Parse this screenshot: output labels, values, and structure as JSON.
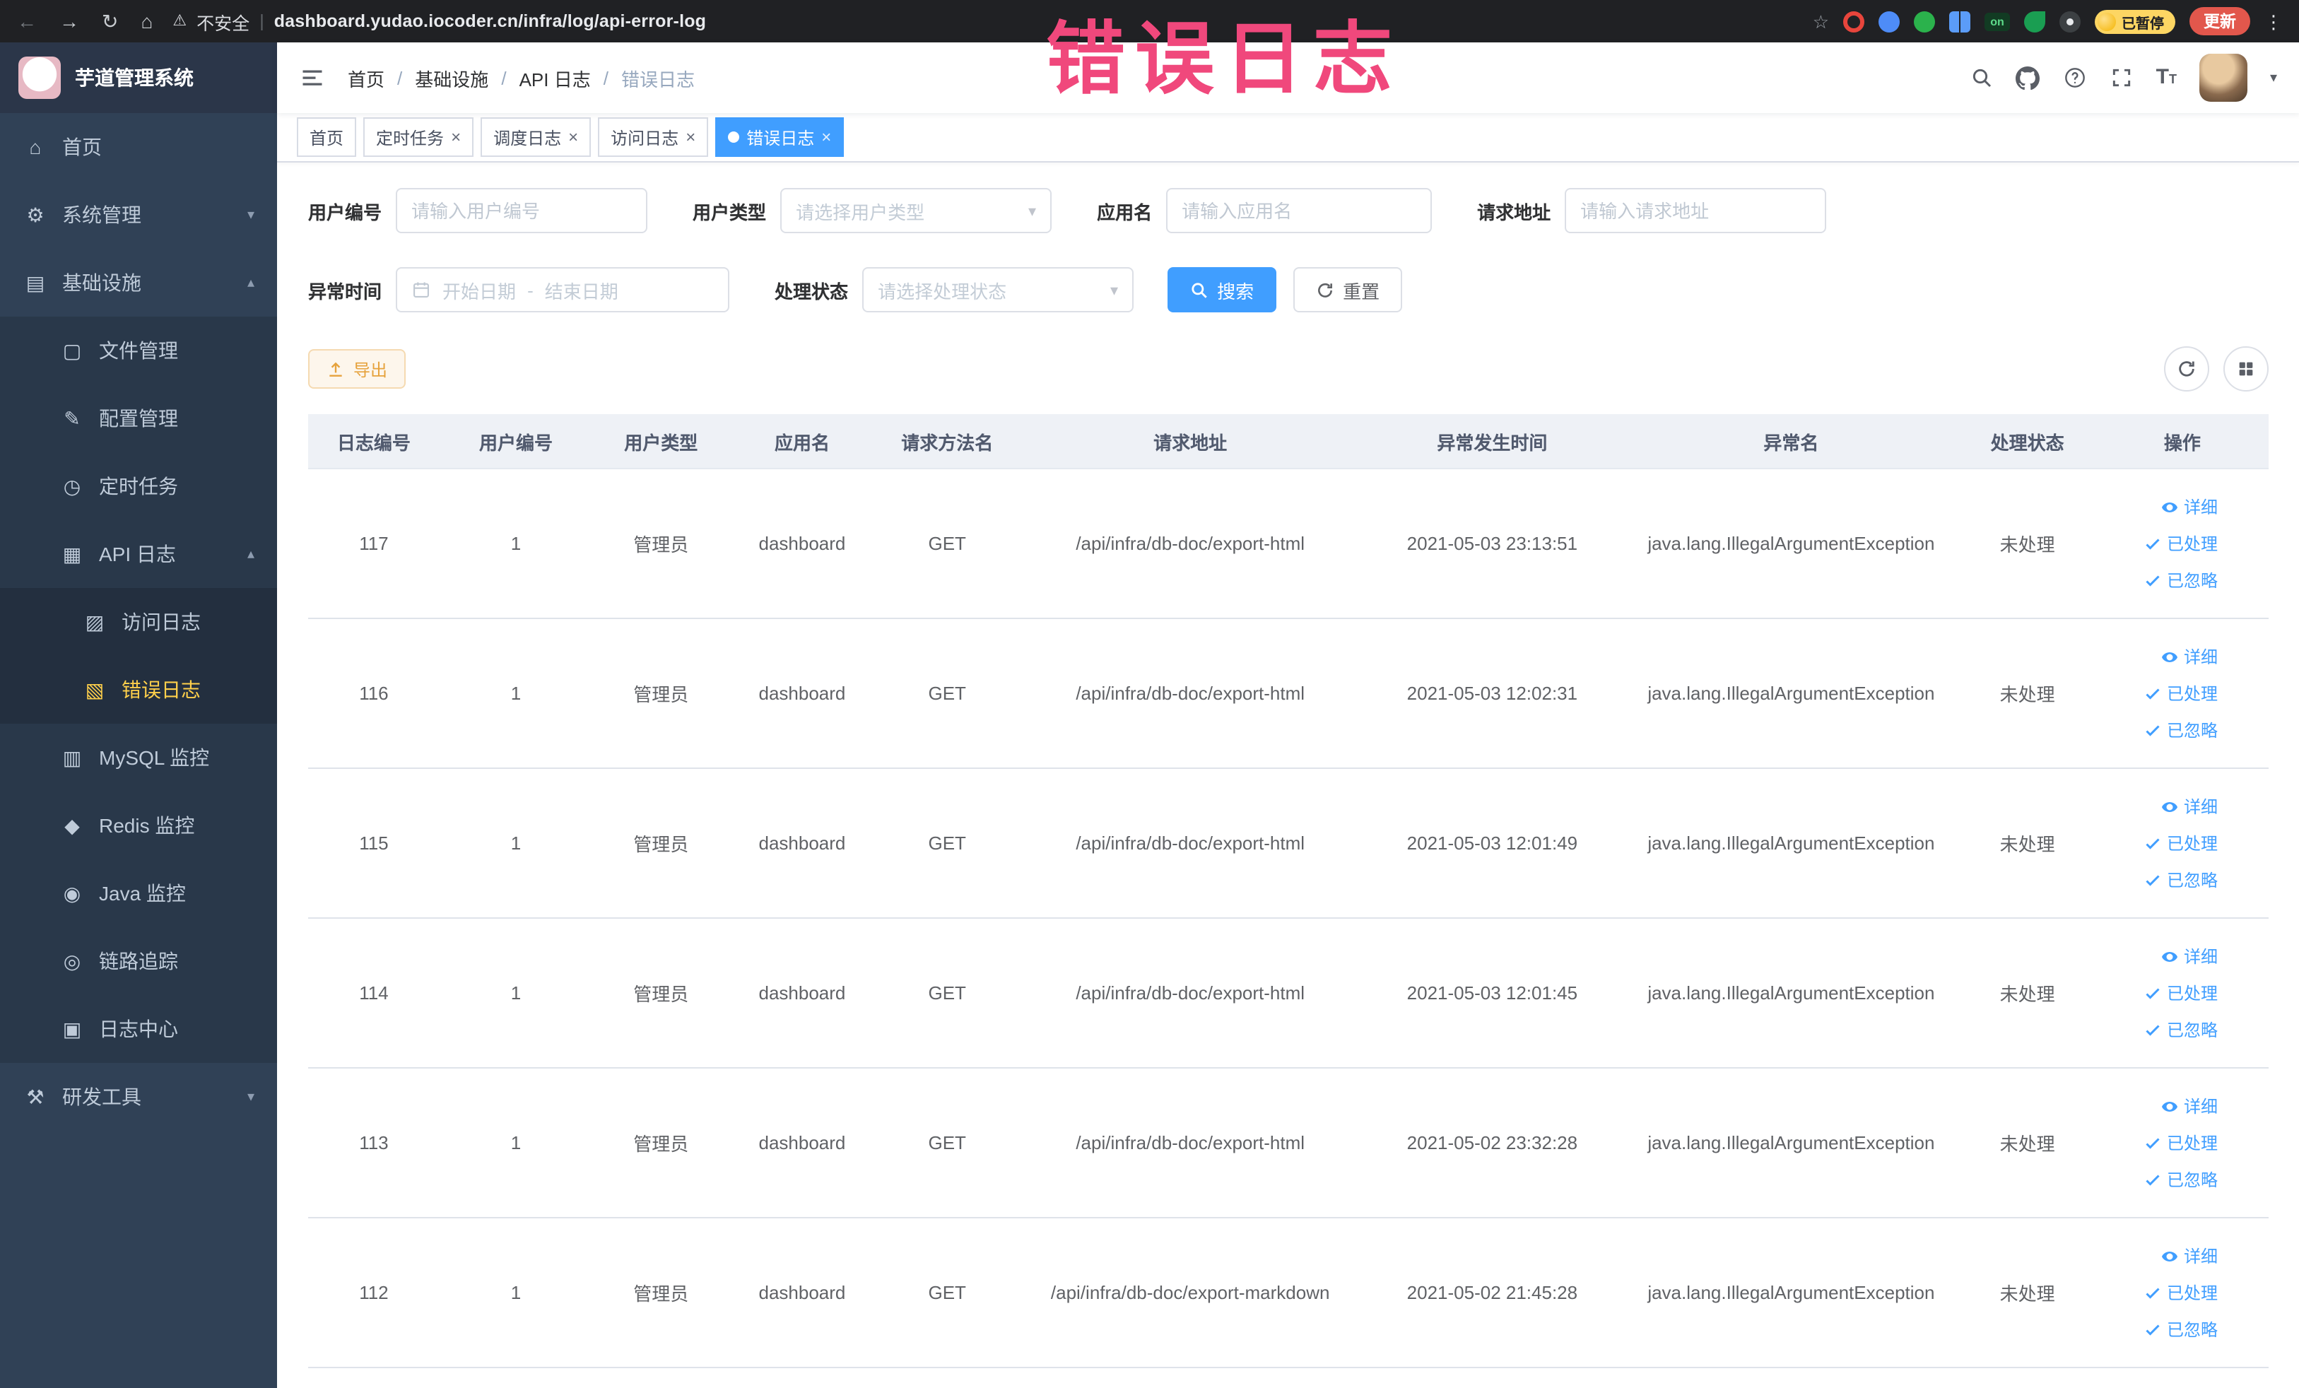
{
  "browser": {
    "security_label": "不安全",
    "url": "dashboard.yudao.iocoder.cn/infra/log/api-error-log",
    "paused_badge": "已暂停",
    "update_label": "更新",
    "ext_on_label": "on"
  },
  "annotation": {
    "text": "错误日志",
    "color": "#f0487c"
  },
  "sidebar": {
    "logo_title": "芋道管理系统",
    "items": {
      "home": "首页",
      "system": "系统管理",
      "infra": "基础设施",
      "file": "文件管理",
      "config": "配置管理",
      "job": "定时任务",
      "api_log": "API 日志",
      "access_log": "访问日志",
      "error_log": "错误日志",
      "mysql": "MySQL 监控",
      "redis": "Redis 监控",
      "java": "Java 监控",
      "trace": "链路追踪",
      "log_center": "日志中心",
      "dev_tools": "研发工具"
    }
  },
  "header": {
    "breadcrumb": [
      "首页",
      "基础设施",
      "API 日志",
      "错误日志"
    ],
    "separator": "/"
  },
  "tabs": [
    {
      "label": "首页",
      "closable": false,
      "active": false
    },
    {
      "label": "定时任务",
      "closable": true,
      "active": false
    },
    {
      "label": "调度日志",
      "closable": true,
      "active": false
    },
    {
      "label": "访问日志",
      "closable": true,
      "active": false
    },
    {
      "label": "错误日志",
      "closable": true,
      "active": true
    }
  ],
  "filters": {
    "user_id": {
      "label": "用户编号",
      "placeholder": "请输入用户编号"
    },
    "user_type": {
      "label": "用户类型",
      "placeholder": "请选择用户类型"
    },
    "app_name": {
      "label": "应用名",
      "placeholder": "请输入应用名"
    },
    "request_url": {
      "label": "请求地址",
      "placeholder": "请输入请求地址"
    },
    "exception_time": {
      "label": "异常时间",
      "start_placeholder": "开始日期",
      "end_placeholder": "结束日期",
      "separator": "-"
    },
    "process_status": {
      "label": "处理状态",
      "placeholder": "请选择处理状态"
    },
    "search_label": "搜索",
    "reset_label": "重置"
  },
  "toolbar": {
    "export_label": "导出"
  },
  "table": {
    "columns": [
      "日志编号",
      "用户编号",
      "用户类型",
      "应用名",
      "请求方法名",
      "请求地址",
      "异常发生时间",
      "异常名",
      "处理状态",
      "操作"
    ],
    "row_actions": [
      {
        "label": "详细"
      },
      {
        "label": "已处理"
      },
      {
        "label": "已忽略"
      }
    ],
    "rows": [
      {
        "log_id": "117",
        "user_id": "1",
        "user_type": "管理员",
        "app_name": "dashboard",
        "method": "GET",
        "url": "/api/infra/db-doc/export-html",
        "time": "2021-05-03 23:13:51",
        "exception": "java.lang.IllegalArgumentException",
        "status": "未处理"
      },
      {
        "log_id": "116",
        "user_id": "1",
        "user_type": "管理员",
        "app_name": "dashboard",
        "method": "GET",
        "url": "/api/infra/db-doc/export-html",
        "time": "2021-05-03 12:02:31",
        "exception": "java.lang.IllegalArgumentException",
        "status": "未处理"
      },
      {
        "log_id": "115",
        "user_id": "1",
        "user_type": "管理员",
        "app_name": "dashboard",
        "method": "GET",
        "url": "/api/infra/db-doc/export-html",
        "time": "2021-05-03 12:01:49",
        "exception": "java.lang.IllegalArgumentException",
        "status": "未处理"
      },
      {
        "log_id": "114",
        "user_id": "1",
        "user_type": "管理员",
        "app_name": "dashboard",
        "method": "GET",
        "url": "/api/infra/db-doc/export-html",
        "time": "2021-05-03 12:01:45",
        "exception": "java.lang.IllegalArgumentException",
        "status": "未处理"
      },
      {
        "log_id": "113",
        "user_id": "1",
        "user_type": "管理员",
        "app_name": "dashboard",
        "method": "GET",
        "url": "/api/infra/db-doc/export-html",
        "time": "2021-05-02 23:32:28",
        "exception": "java.lang.IllegalArgumentException",
        "status": "未处理"
      },
      {
        "log_id": "112",
        "user_id": "1",
        "user_type": "管理员",
        "app_name": "dashboard",
        "method": "GET",
        "url": "/api/infra/db-doc/export-markdown",
        "time": "2021-05-02 21:45:28",
        "exception": "java.lang.IllegalArgumentException",
        "status": "未处理"
      }
    ]
  },
  "colors": {
    "primary": "#409eff",
    "warning": "#e6a23c",
    "sidebar_bg": "#304156",
    "sidebar_active": "#ffd04b",
    "annotation": "#f0487c"
  }
}
